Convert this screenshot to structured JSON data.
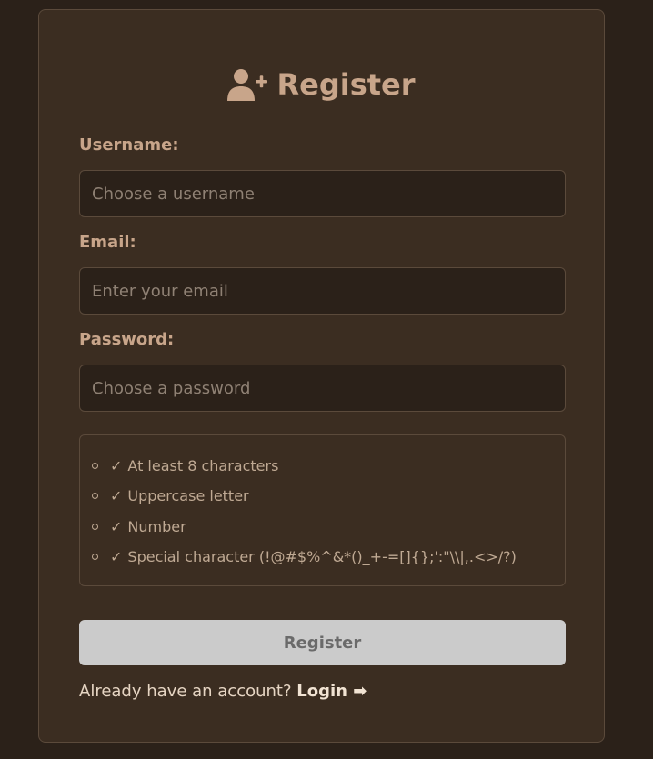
{
  "header": {
    "title": "Register",
    "icon": "user-plus-icon"
  },
  "form": {
    "username": {
      "label": "Username:",
      "placeholder": "Choose a username",
      "value": ""
    },
    "email": {
      "label": "Email:",
      "placeholder": "Enter your email",
      "value": ""
    },
    "password": {
      "label": "Password:",
      "placeholder": "Choose a password",
      "value": ""
    }
  },
  "requirements": {
    "check_mark": "✓",
    "items": [
      "At least 8 characters",
      "Uppercase letter",
      "Number",
      "Special character (!@#$%^&*()_+-=[]{};':\"\\\\|,.<>/?)"
    ]
  },
  "actions": {
    "register_label": "Register",
    "login_prompt": "Already have an account?",
    "login_label": "Login",
    "login_arrow": "➡"
  },
  "colors": {
    "page_background": "#2b2119",
    "card_background": "#3b2d21",
    "accent": "#c8a58a",
    "button_disabled": "#cbcbcb"
  }
}
